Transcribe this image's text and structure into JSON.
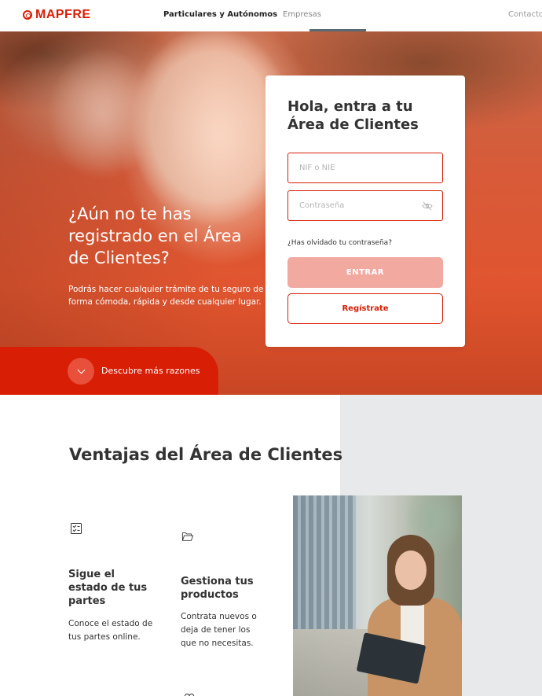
{
  "header": {
    "logo_text": "MAPFRE",
    "nav": {
      "particulares": "Particulares y Autónomos",
      "empresas": "Empresas",
      "contacto": "Contacto"
    }
  },
  "hero": {
    "title": "¿Aún no te has registrado en el Área de Clientes?",
    "subtitle": "Podrás hacer cualquier trámite de tu seguro de forma cómoda, rápida y desde cualquier lugar.",
    "discover_label": "Descubre más razones"
  },
  "login": {
    "title": "Hola, entra a tu Área de Clientes",
    "nif_placeholder": "NIF o NIE",
    "password_placeholder": "Contraseña",
    "forgot_label": "¿Has olvidado tu contraseña?",
    "enter_label": "ENTRAR",
    "register_label": "Regístrate"
  },
  "advantages": {
    "title": "Ventajas del Área de Clientes",
    "features": [
      {
        "icon": "checklist-icon",
        "title": "Sigue el estado de tus partes",
        "description": "Conoce el estado de tus partes online."
      },
      {
        "icon": "folder-icon",
        "title": "Gestiona tus productos",
        "description": "Contrata nuevos o deja de tener los que no necesitas."
      }
    ]
  },
  "colors": {
    "brand_red": "#d81e05",
    "button_disabled": "#f2a9a0",
    "grey_panel": "#e7e9eb"
  }
}
